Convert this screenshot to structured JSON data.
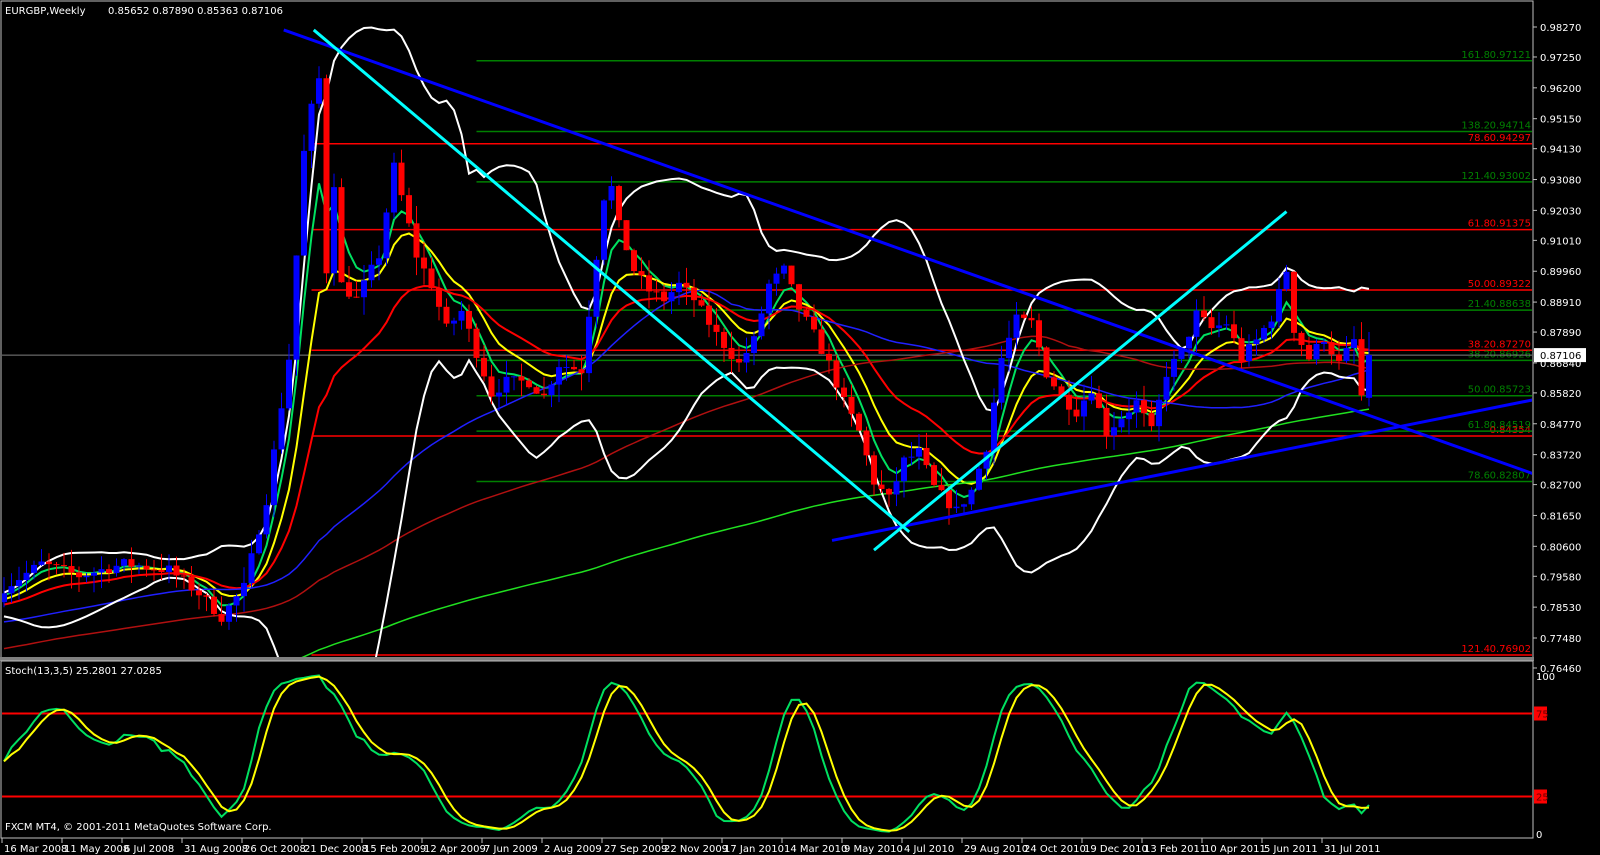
{
  "header": {
    "symbol_period": "EURGBP,Weekly",
    "ohlc": "0.85652 0.87890 0.85363 0.87106"
  },
  "footer": {
    "copyright": "FXCM MT4, © 2001-2011 MetaQuotes Software Corp."
  },
  "colors": {
    "background": "#000000",
    "bull": "#0000ff",
    "bear": "#ff0000",
    "grid": "#c0c0c0",
    "ma_fast": "#00e060",
    "ma_mid": "#ffff00",
    "ma_slow": "#ff0000",
    "ma_55": "#2020ff",
    "ma_100": "#b01010",
    "ma_200": "#20e020",
    "bollinger": "#ffffff",
    "stoch_main": "#00e060",
    "stoch_signal": "#ffff00",
    "fib_red": "#ff0000",
    "fib_green": "#008000",
    "trend_blue": "#0000ff",
    "trend_cyan": "#00ffff"
  },
  "chart_data": [
    {
      "type": "candlestick",
      "title": "EURGBP,Weekly",
      "ylim": [
        0.7646,
        0.9827
      ],
      "y_ticks": [
        "0.98270",
        "0.97250",
        "0.96200",
        "0.95150",
        "0.94130",
        "0.93080",
        "0.92030",
        "0.91010",
        "0.89960",
        "0.88910",
        "0.87890",
        "0.86840",
        "0.85820",
        "0.84770",
        "0.83720",
        "0.82700",
        "0.81650",
        "0.80600",
        "0.79580",
        "0.78530",
        "0.77480",
        "0.76460"
      ],
      "x_ticks": [
        "16 Mar 2008",
        "11 May 2008",
        "6 Jul 2008",
        "31 Aug 2008",
        "26 Oct 2008",
        "21 Dec 2008",
        "15 Feb 2009",
        "12 Apr 2009",
        "7 Jun 2009",
        "2 Aug 2009",
        "27 Sep 2009",
        "22 Nov 2009",
        "17 Jan 2010",
        "14 Mar 2010",
        "9 May 2010",
        "4 Jul 2010",
        "29 Aug 2010",
        "24 Oct 2010",
        "19 Dec 2010",
        "13 Feb 2011",
        "10 Apr 2011",
        "5 Jun 2011",
        "31 Jul 2011"
      ],
      "weeks_per_tick": 8,
      "current_price": "0.87106",
      "last_bar": {
        "open": 0.85652,
        "high": 0.8789,
        "low": 0.85363,
        "close": 0.87106
      },
      "close_path_week_price": [
        [
          0,
          0.792
        ],
        [
          5,
          0.8
        ],
        [
          10,
          0.796
        ],
        [
          16,
          0.8
        ],
        [
          22,
          0.798
        ],
        [
          26,
          0.79
        ],
        [
          29,
          0.782
        ],
        [
          32,
          0.792
        ],
        [
          35,
          0.822
        ],
        [
          38,
          0.87
        ],
        [
          40,
          0.94
        ],
        [
          41,
          0.955
        ],
        [
          42,
          0.965
        ],
        [
          43,
          0.9
        ],
        [
          44,
          0.93
        ],
        [
          45,
          0.895
        ],
        [
          47,
          0.89
        ],
        [
          50,
          0.905
        ],
        [
          52,
          0.935
        ],
        [
          53,
          0.925
        ],
        [
          55,
          0.905
        ],
        [
          57,
          0.895
        ],
        [
          59,
          0.88
        ],
        [
          61,
          0.886
        ],
        [
          63,
          0.872
        ],
        [
          65,
          0.858
        ],
        [
          67,
          0.862
        ],
        [
          70,
          0.862
        ],
        [
          72,
          0.857
        ],
        [
          74,
          0.868
        ],
        [
          77,
          0.866
        ],
        [
          79,
          0.905
        ],
        [
          80,
          0.925
        ],
        [
          81,
          0.928
        ],
        [
          82,
          0.915
        ],
        [
          84,
          0.9
        ],
        [
          86,
          0.893
        ],
        [
          88,
          0.89
        ],
        [
          90,
          0.895
        ],
        [
          92,
          0.89
        ],
        [
          95,
          0.878
        ],
        [
          98,
          0.868
        ],
        [
          100,
          0.876
        ],
        [
          102,
          0.895
        ],
        [
          104,
          0.9
        ],
        [
          106,
          0.887
        ],
        [
          108,
          0.878
        ],
        [
          110,
          0.868
        ],
        [
          112,
          0.855
        ],
        [
          114,
          0.845
        ],
        [
          116,
          0.828
        ],
        [
          118,
          0.822
        ],
        [
          120,
          0.835
        ],
        [
          122,
          0.838
        ],
        [
          124,
          0.826
        ],
        [
          127,
          0.818
        ],
        [
          129,
          0.825
        ],
        [
          131,
          0.84
        ],
        [
          133,
          0.87
        ],
        [
          135,
          0.883
        ],
        [
          137,
          0.882
        ],
        [
          139,
          0.865
        ],
        [
          141,
          0.857
        ],
        [
          143,
          0.852
        ],
        [
          145,
          0.86
        ],
        [
          147,
          0.845
        ],
        [
          149,
          0.85
        ],
        [
          151,
          0.855
        ],
        [
          153,
          0.845
        ],
        [
          155,
          0.865
        ],
        [
          157,
          0.872
        ],
        [
          159,
          0.885
        ],
        [
          161,
          0.88
        ],
        [
          163,
          0.882
        ],
        [
          165,
          0.87
        ],
        [
          167,
          0.876
        ],
        [
          169,
          0.884
        ],
        [
          171,
          0.9
        ],
        [
          172,
          0.88
        ],
        [
          174,
          0.87
        ],
        [
          176,
          0.877
        ],
        [
          178,
          0.868
        ],
        [
          180,
          0.876
        ],
        [
          181,
          0.857
        ],
        [
          182,
          0.871
        ]
      ],
      "prior_level": 0.7,
      "moving_averages": [
        {
          "name": "ma_fast",
          "period": 5
        },
        {
          "name": "ma_mid",
          "period": 10
        },
        {
          "name": "ma_slow",
          "period": 21
        },
        {
          "name": "ma_55",
          "period": 55
        },
        {
          "name": "ma_100",
          "period": 100
        },
        {
          "name": "ma_200",
          "period": 200
        }
      ],
      "bollinger": {
        "period": 20,
        "deviations": 2
      },
      "fibonacci": [
        {
          "color": "fib_red",
          "start_week": 41,
          "levels": [
            {
              "label": "78.6",
              "value": "0.94297"
            },
            {
              "label": "61.8",
              "value": "0.91375"
            },
            {
              "label": "50.0",
              "value": "0.89322"
            },
            {
              "label": "38.2",
              "value": "0.87270"
            },
            {
              "label": "",
              "value": "0.84354"
            },
            {
              "label": "121.4",
              "value": "0.76902"
            }
          ]
        },
        {
          "color": "fib_green",
          "start_week": 63,
          "levels": [
            {
              "label": "161.8",
              "value": "0.97121"
            },
            {
              "label": "138.2",
              "value": "0.94714"
            },
            {
              "label": "121.4",
              "value": "0.93002"
            },
            {
              "label": "21.4",
              "value": "0.88638"
            },
            {
              "label": "38.2",
              "value": "0.86926"
            },
            {
              "label": "50.0",
              "value": "0.85723"
            },
            {
              "label": "61.8",
              "value": "0.84519"
            },
            {
              "label": "78.6",
              "value": "0.82807"
            }
          ]
        }
      ],
      "trendlines": [
        {
          "color": "trend_blue",
          "from": [
            37.3,
            0.9817
          ],
          "to": [
            204,
            0.8306
          ]
        },
        {
          "color": "trend_blue",
          "from": [
            110.4,
            0.808
          ],
          "to": [
            204,
            0.8559
          ]
        },
        {
          "color": "trend_cyan",
          "from": [
            41.3,
            0.9817
          ],
          "to": [
            120.7,
            0.8109
          ]
        },
        {
          "color": "trend_cyan",
          "from": [
            116,
            0.8047
          ],
          "to": [
            171,
            0.9199
          ]
        }
      ]
    },
    {
      "type": "line",
      "title": "Stoch(13,3,5) 25.2801 27.0285",
      "label": "Stoch(13,3,5) 25.2801 27.0285",
      "ylim": [
        0,
        100
      ],
      "y_ticks": [
        "100",
        "75",
        "25",
        "0"
      ],
      "levels": [
        75,
        25
      ],
      "params": {
        "k": 13,
        "d": 3,
        "slowing": 5
      },
      "last_values": {
        "main": 25.2801,
        "signal": 27.0285
      }
    }
  ]
}
